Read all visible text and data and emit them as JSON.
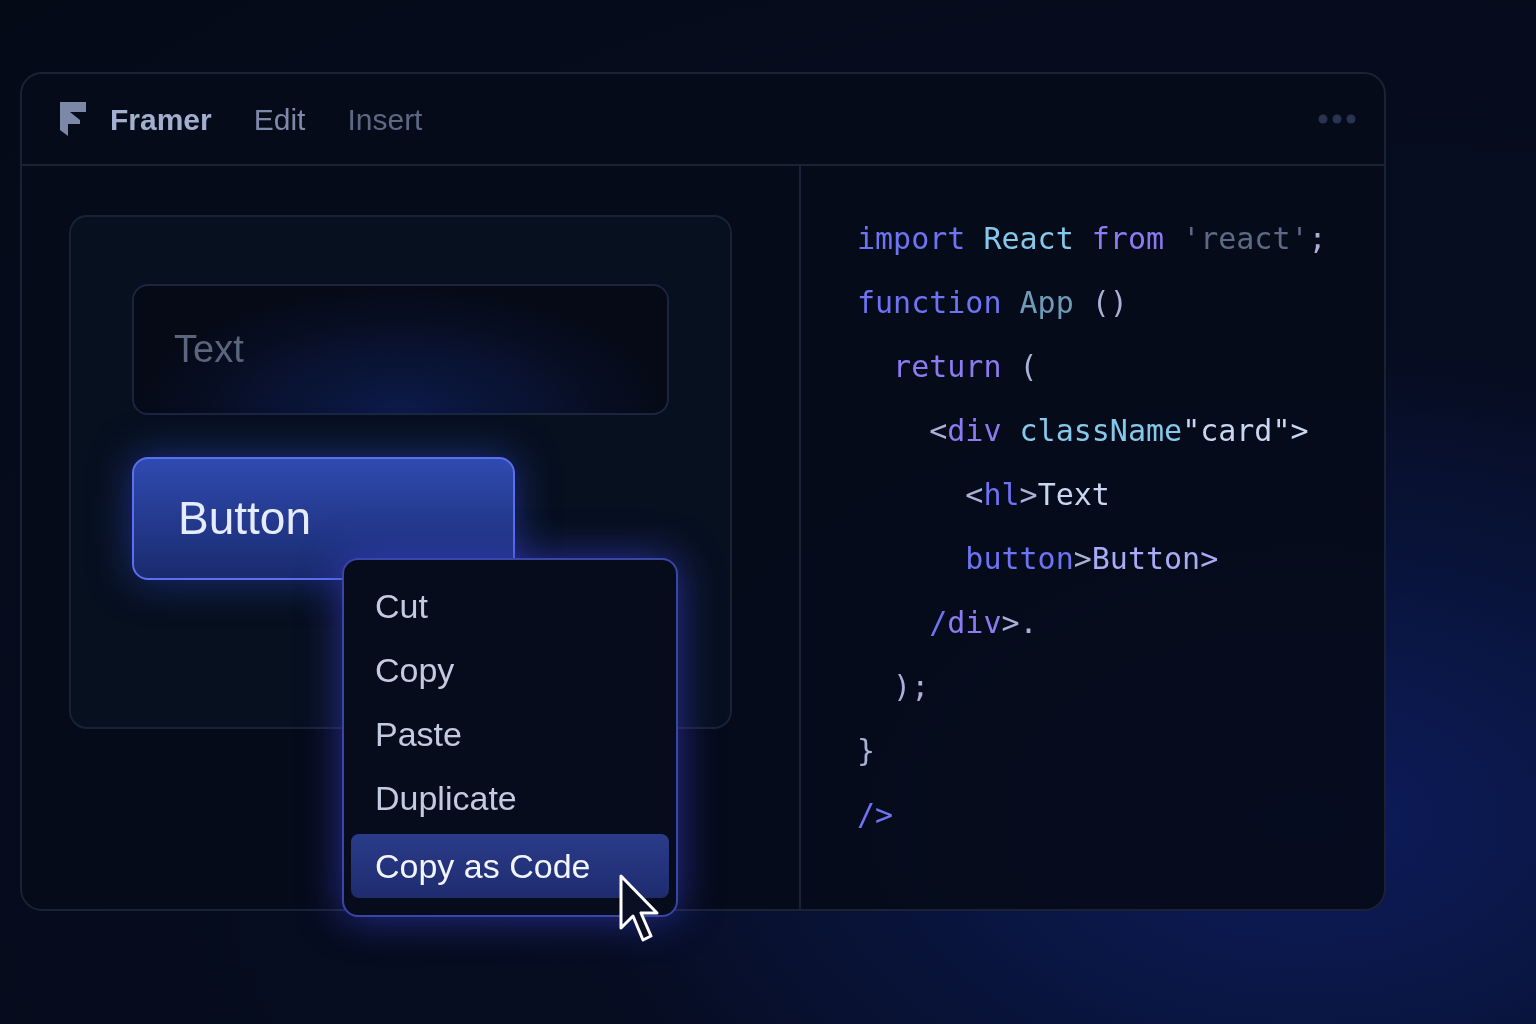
{
  "menu_bar": {
    "items": [
      {
        "label": "Framer",
        "kind": "app"
      },
      {
        "label": "Edit",
        "kind": "menu"
      },
      {
        "label": "Insert",
        "kind": "dim"
      }
    ]
  },
  "canvas": {
    "text_field": {
      "placeholder": "Text"
    },
    "button": {
      "label": "Button"
    }
  },
  "context_menu": {
    "items": [
      {
        "label": "Cut",
        "selected": false
      },
      {
        "label": "Copy",
        "selected": false
      },
      {
        "label": "Paste",
        "selected": false
      },
      {
        "label": "Duplicate",
        "selected": false
      },
      {
        "label": "Copy as Code",
        "selected": true
      }
    ]
  },
  "code": {
    "lines": [
      [
        {
          "text": "import ",
          "kind": "keyword"
        },
        {
          "text": "React ",
          "kind": "name"
        },
        {
          "text": "from ",
          "kind": "keyword2"
        },
        {
          "text": "'react'",
          "kind": "string"
        },
        {
          "text": ";",
          "kind": "punct"
        }
      ],
      [
        {
          "text": "function ",
          "kind": "keyword"
        },
        {
          "text": "App ",
          "kind": "name2"
        },
        {
          "text": "()",
          "kind": "punct"
        }
      ],
      [
        {
          "text": "  return ",
          "kind": "keyword2"
        },
        {
          "text": "(",
          "kind": "punct"
        }
      ],
      [
        {
          "text": "    <",
          "kind": "punct"
        },
        {
          "text": "div ",
          "kind": "keyword2"
        },
        {
          "text": "className",
          "kind": "name"
        },
        {
          "text": "\"card\">",
          "kind": "text"
        }
      ],
      [
        {
          "text": "      <",
          "kind": "punct"
        },
        {
          "text": "hl",
          "kind": "keyword"
        },
        {
          "text": ">",
          "kind": "punct"
        },
        {
          "text": "Text",
          "kind": "text"
        }
      ],
      [
        {
          "text": "      button",
          "kind": "keyword"
        },
        {
          "text": ">",
          "kind": "punct"
        },
        {
          "text": "Button>",
          "kind": "text2"
        }
      ],
      [
        {
          "text": "    /",
          "kind": "keyword"
        },
        {
          "text": "div",
          "kind": "keyword2"
        },
        {
          "text": ">.",
          "kind": "punct"
        }
      ],
      [
        {
          "text": "  );",
          "kind": "punct"
        }
      ],
      [
        {
          "text": "}",
          "kind": "punct"
        }
      ],
      [
        {
          "text": "/>",
          "kind": "keyword"
        }
      ]
    ]
  }
}
